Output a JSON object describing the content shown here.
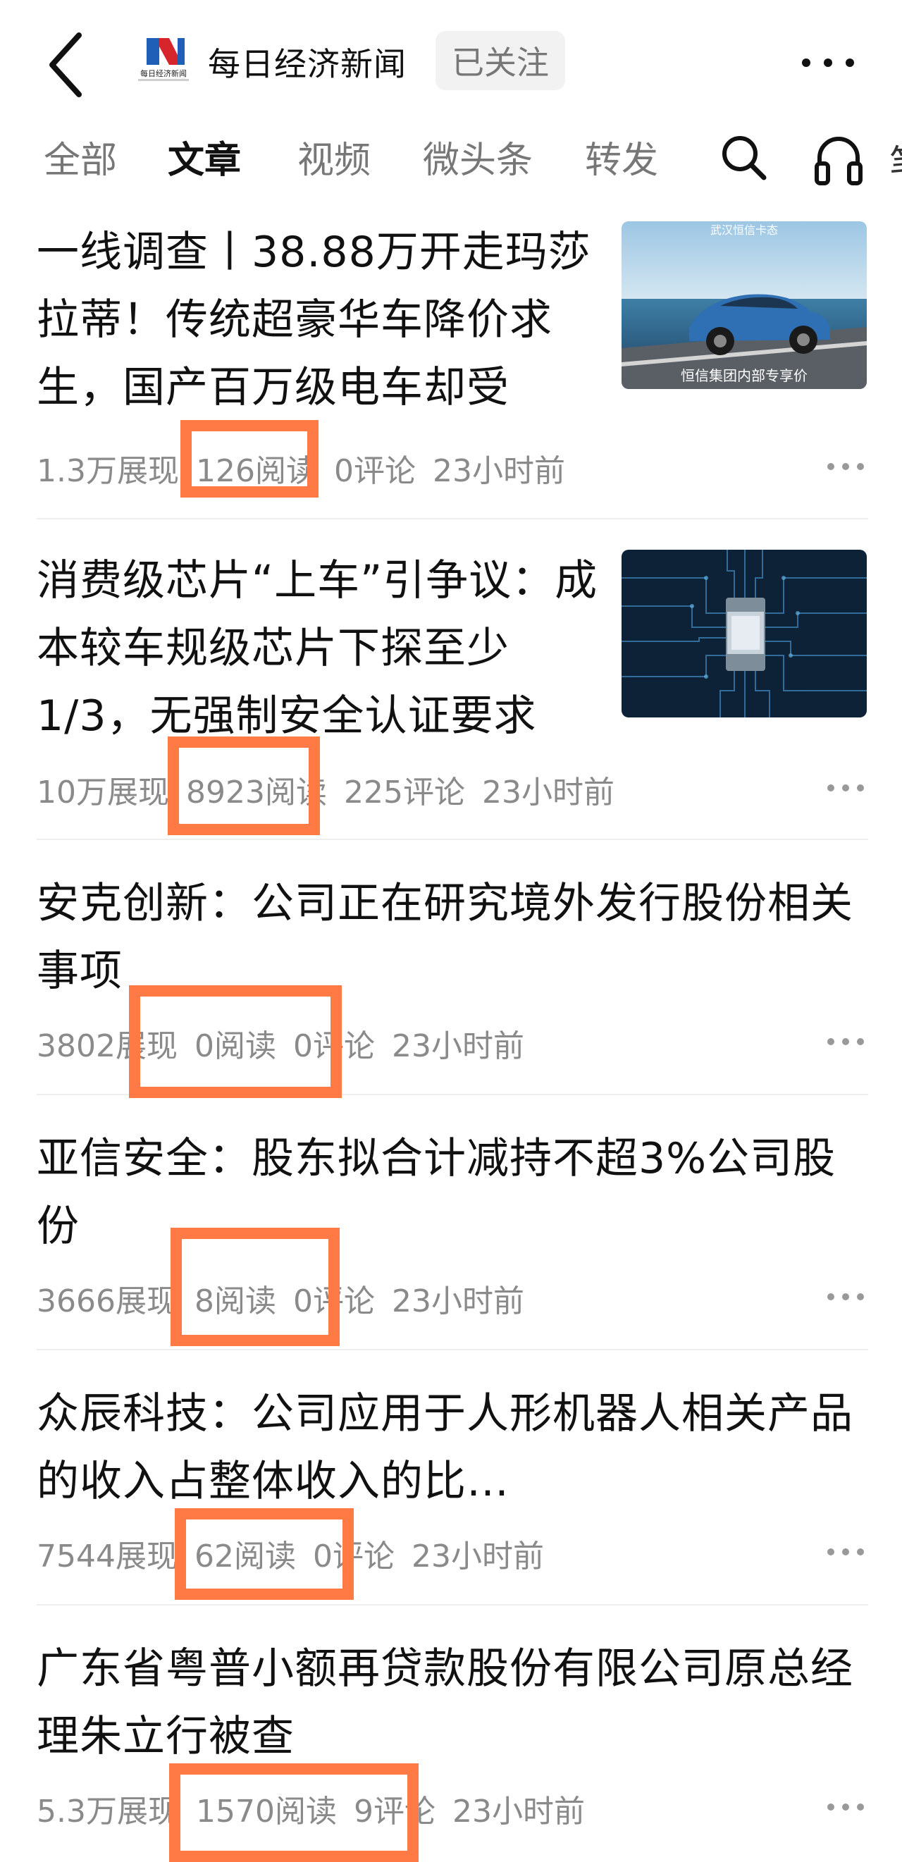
{
  "header": {
    "account_name": "每日经济新闻",
    "follow_label": "已关注",
    "logo_text": "每日经济新闻"
  },
  "tabs": [
    {
      "label": "全部",
      "active": false
    },
    {
      "label": "文章",
      "active": true
    },
    {
      "label": "视频",
      "active": false
    },
    {
      "label": "微头条",
      "active": false
    },
    {
      "label": "转发",
      "active": false
    }
  ],
  "tab_overflow_glyph": "笔",
  "articles": [
    {
      "title": "一线调查丨38.88万开走玛莎拉蒂！传统超豪华车降价求生，国产百万级电车却受",
      "impressions": "1.3万展现",
      "reads": "126阅读",
      "comments": "0评论",
      "time": "23小时前",
      "thumb_caption": "恒信集团内部专享价",
      "thumb_top_text": "武汉恒信卡态"
    },
    {
      "title": "消费级芯片“上车”引争议：成本较车规级芯片下探至少1/3，无强制安全认证要求",
      "impressions": "10万展现",
      "reads": "8923阅读",
      "comments": "225评论",
      "time": "23小时前"
    },
    {
      "title": "安克创新：公司正在研究境外发行股份相关事项",
      "impressions": "3802展现",
      "reads": "0阅读",
      "comments": "0评论",
      "time": "23小时前"
    },
    {
      "title": "亚信安全：股东拟合计减持不超3%公司股份",
      "impressions": "3666展现",
      "reads": "8阅读",
      "comments": "0评论",
      "time": "23小时前"
    },
    {
      "title": "众辰科技：公司应用于人形机器人相关产品的收入占整体收入的比…",
      "impressions": "7544展现",
      "reads": "62阅读",
      "comments": "0评论",
      "time": "23小时前"
    },
    {
      "title": "广东省粤普小额再贷款股份有限公司原总经理朱立行被查",
      "impressions": "5.3万展现",
      "reads": "1570阅读",
      "comments": "9评论",
      "time": "23小时前"
    }
  ],
  "colors": {
    "highlight": "#ff7a45",
    "meta_text": "#8a8a8a",
    "follow_bg": "#f2f2f2"
  }
}
